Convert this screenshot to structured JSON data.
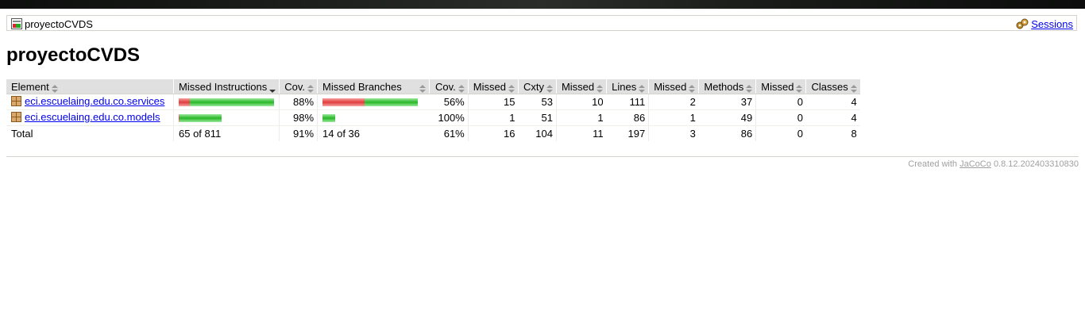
{
  "breadcrumb": {
    "project": "proyectoCVDS",
    "sessions_label": "Sessions"
  },
  "page_title": "proyectoCVDS",
  "table": {
    "headers": {
      "element": "Element",
      "missed_instructions": "Missed Instructions",
      "instr_cov": "Cov.",
      "missed_branches": "Missed Branches",
      "branch_cov": "Cov.",
      "missed_cxty": "Missed",
      "cxty": "Cxty",
      "missed_lines": "Missed",
      "lines": "Lines",
      "missed_methods": "Missed",
      "methods": "Methods",
      "missed_classes": "Missed",
      "classes": "Classes"
    },
    "rows": [
      {
        "name": "eci.escuelaing.edu.co.services",
        "instr_missed_pct": 12,
        "instr_covered_pct": 88,
        "instr_bar_scale": 1.0,
        "instr_cov": "88%",
        "branch_missed_pct": 44,
        "branch_covered_pct": 56,
        "branch_bar_scale": 1.0,
        "branch_cov": "56%",
        "missed_cxty": "15",
        "cxty": "53",
        "missed_lines": "10",
        "lines": "111",
        "missed_methods": "2",
        "methods": "37",
        "missed_classes": "0",
        "classes": "4"
      },
      {
        "name": "eci.escuelaing.edu.co.models",
        "instr_missed_pct": 2,
        "instr_covered_pct": 98,
        "instr_bar_scale": 0.45,
        "instr_cov": "98%",
        "branch_missed_pct": 0,
        "branch_covered_pct": 100,
        "branch_bar_scale": 0.13,
        "branch_cov": "100%",
        "missed_cxty": "1",
        "cxty": "51",
        "missed_lines": "1",
        "lines": "86",
        "missed_methods": "1",
        "methods": "49",
        "missed_classes": "0",
        "classes": "4"
      }
    ],
    "total": {
      "label": "Total",
      "missed_instructions": "65 of 811",
      "instr_cov": "91%",
      "missed_branches": "14 of 36",
      "branch_cov": "61%",
      "missed_cxty": "16",
      "cxty": "104",
      "missed_lines": "11",
      "lines": "197",
      "missed_methods": "3",
      "methods": "86",
      "missed_classes": "0",
      "classes": "8"
    }
  },
  "footer": {
    "prefix": "Created with",
    "tool": "JaCoCo",
    "version": "0.8.12.202403310830"
  },
  "colors": {
    "missed": "#e03b3b",
    "covered": "#28b828",
    "header_bg": "#e0e0e0"
  }
}
